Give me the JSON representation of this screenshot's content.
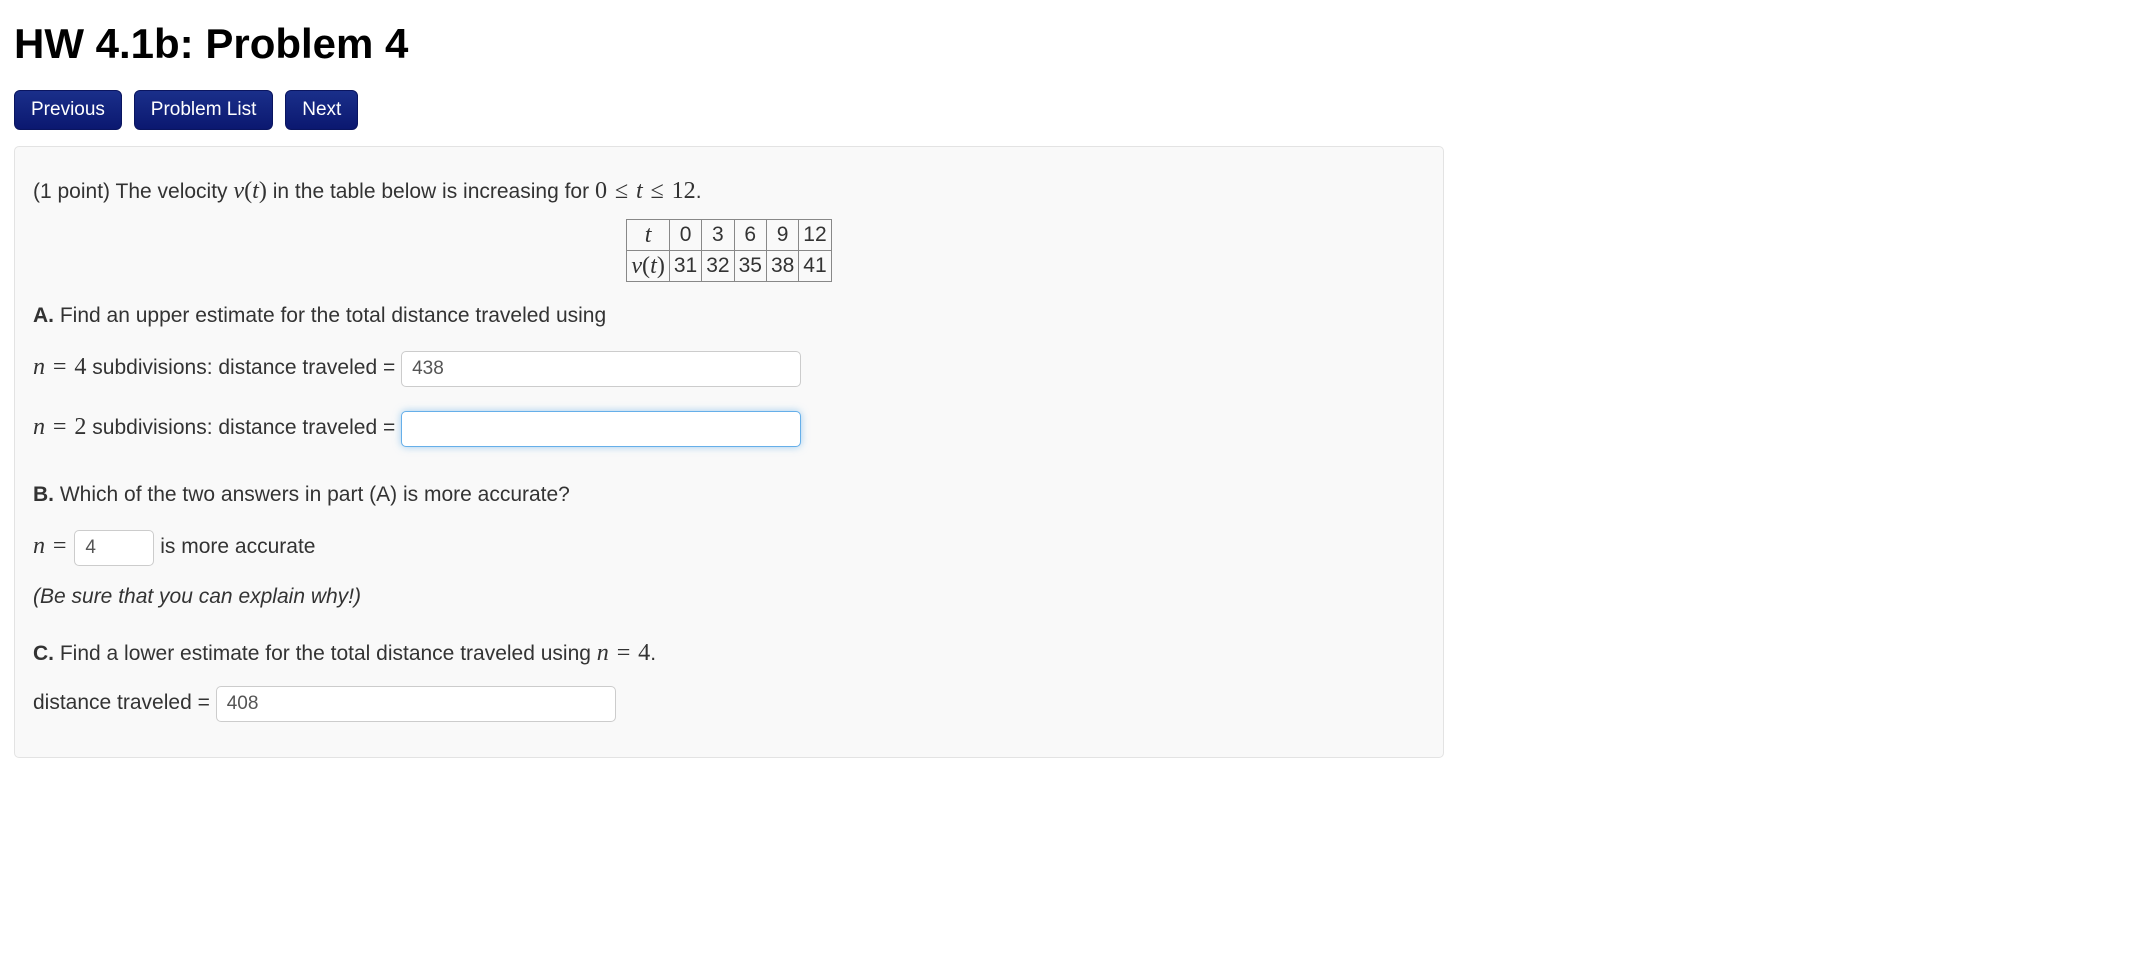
{
  "page_title": "HW 4.1b: Problem 4",
  "nav": {
    "previous": "Previous",
    "problem_list": "Problem List",
    "next": "Next"
  },
  "intro": {
    "points": "(1 point) ",
    "lead": "The velocity ",
    "mid": " in the table below is increasing for ",
    "range_lhs": "0",
    "range_op1": "≤",
    "range_var": "t",
    "range_op2": "≤",
    "range_rhs": "12",
    "period": "."
  },
  "chart_data": {
    "type": "table",
    "row_labels": [
      "t",
      "v(t)"
    ],
    "columns": [
      "0",
      "3",
      "6",
      "9",
      "12"
    ],
    "rows": {
      "t": [
        "0",
        "3",
        "6",
        "9",
        "12"
      ],
      "v(t)": [
        "31",
        "32",
        "35",
        "38",
        "41"
      ]
    }
  },
  "partA": {
    "label": "A.",
    "text": " Find an upper estimate for the total distance traveled using",
    "n4_prefix_var": "n",
    "n4_eq": "=",
    "n4_val": "4",
    "n4_suffix": " subdivisions: distance traveled = ",
    "n4_answer": "438",
    "n2_prefix_var": "n",
    "n2_eq": "=",
    "n2_val": "2",
    "n2_suffix": " subdivisions: distance traveled = ",
    "n2_answer": ""
  },
  "partB": {
    "label": "B.",
    "text": " Which of the two answers in part (A) is more accurate?",
    "n_var": "n",
    "n_eq": "=",
    "n_answer": "4",
    "suffix": " is more accurate",
    "note": "(Be sure that you can explain why!)"
  },
  "partC": {
    "label": "C.",
    "text_lead": " Find a lower estimate for the total distance traveled using ",
    "n_var": "n",
    "n_eq": "=",
    "n_val": "4",
    "period": ".",
    "dist_label": "distance traveled = ",
    "dist_answer": "408"
  }
}
